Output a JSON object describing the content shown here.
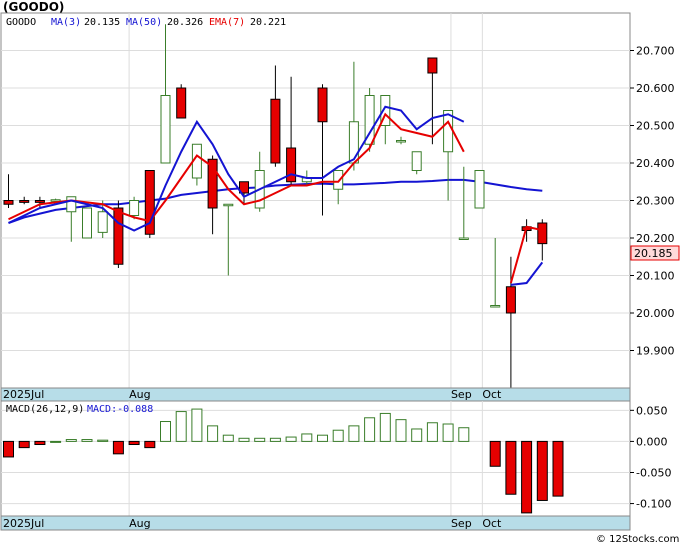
{
  "title": "(GOODO)",
  "legend": {
    "symbol": "GOODO",
    "ma3": "MA(3)",
    "ma3_value": "20.135",
    "ma50": "MA(50)",
    "ma50_value": "20.326",
    "ema7": "EMA(7)",
    "ema7_value": "20.221"
  },
  "macd_legend": {
    "label": "MACD(26,12,9)",
    "value_label": "MACD:-0.088"
  },
  "last_price_tag": "20.185",
  "watermark": "© 12Stocks.com",
  "chart_data": [
    {
      "type": "candlestick",
      "title": "(GOODO)",
      "ylim": [
        19.8,
        20.8
      ],
      "yticks": [
        "19.900",
        "20.000",
        "20.100",
        "20.200",
        "20.300",
        "20.400",
        "20.500",
        "20.600",
        "20.700"
      ],
      "xticks": [
        "2025Jul",
        "Aug",
        "Sep",
        "Oct"
      ],
      "grid": true,
      "colors": {
        "up": "#3a7d2a",
        "down": "#e60000",
        "ma3": "#1414d2",
        "ema7": "#e60000",
        "ma50": "#1414d2"
      },
      "candles": [
        {
          "o": 20.3,
          "h": 20.37,
          "l": 20.28,
          "c": 20.29
        },
        {
          "o": 20.3,
          "h": 20.31,
          "l": 20.29,
          "c": 20.295
        },
        {
          "o": 20.3,
          "h": 20.31,
          "l": 20.28,
          "c": 20.295
        },
        {
          "o": 20.3,
          "h": 20.305,
          "l": 20.295,
          "c": 20.302
        },
        {
          "o": 20.27,
          "h": 20.31,
          "l": 20.19,
          "c": 20.31
        },
        {
          "o": 20.2,
          "h": 20.28,
          "l": 20.2,
          "c": 20.28
        },
        {
          "o": 20.215,
          "h": 20.3,
          "l": 20.2,
          "c": 20.27
        },
        {
          "o": 20.28,
          "h": 20.3,
          "l": 20.12,
          "c": 20.13
        },
        {
          "o": 20.26,
          "h": 20.31,
          "l": 20.25,
          "c": 20.3
        },
        {
          "o": 20.38,
          "h": 20.38,
          "l": 20.2,
          "c": 20.21
        },
        {
          "o": 20.4,
          "h": 20.77,
          "l": 20.42,
          "c": 20.58
        },
        {
          "o": 20.6,
          "h": 20.61,
          "l": 20.52,
          "c": 20.52
        },
        {
          "o": 20.36,
          "h": 20.45,
          "l": 20.34,
          "c": 20.45
        },
        {
          "o": 20.41,
          "h": 20.42,
          "l": 20.21,
          "c": 20.28
        },
        {
          "o": 20.29,
          "h": 20.29,
          "l": 20.1,
          "c": 20.29
        },
        {
          "o": 20.35,
          "h": 20.35,
          "l": 20.29,
          "c": 20.32
        },
        {
          "o": 20.28,
          "h": 20.43,
          "l": 20.27,
          "c": 20.38
        },
        {
          "o": 20.57,
          "h": 20.66,
          "l": 20.39,
          "c": 20.4
        },
        {
          "o": 20.44,
          "h": 20.63,
          "l": 20.34,
          "c": 20.35
        },
        {
          "o": 20.35,
          "h": 20.38,
          "l": 20.34,
          "c": 20.36
        },
        {
          "o": 20.6,
          "h": 20.61,
          "l": 20.26,
          "c": 20.51
        },
        {
          "o": 20.33,
          "h": 20.38,
          "l": 20.29,
          "c": 20.38
        },
        {
          "o": 20.4,
          "h": 20.67,
          "l": 20.38,
          "c": 20.51
        },
        {
          "o": 20.45,
          "h": 20.6,
          "l": 20.43,
          "c": 20.58
        },
        {
          "o": 20.5,
          "h": 20.58,
          "l": 20.45,
          "c": 20.58
        },
        {
          "o": 20.46,
          "h": 20.47,
          "l": 20.45,
          "c": 20.46
        },
        {
          "o": 20.38,
          "h": 20.43,
          "l": 20.37,
          "c": 20.43
        },
        {
          "o": 20.68,
          "h": 20.68,
          "l": 20.45,
          "c": 20.64
        },
        {
          "o": 20.43,
          "h": 20.54,
          "l": 20.3,
          "c": 20.54
        },
        {
          "o": 20.2,
          "h": 20.39,
          "l": 20.2,
          "c": 20.2
        },
        {
          "o": 20.28,
          "h": 20.38,
          "l": 20.28,
          "c": 20.38
        },
        {
          "o": 20.02,
          "h": 20.2,
          "l": 20.02,
          "c": 20.02
        },
        {
          "o": 20.07,
          "h": 20.15,
          "l": 19.8,
          "c": 20.0
        },
        {
          "o": 20.23,
          "h": 20.25,
          "l": 20.19,
          "c": 20.22
        },
        {
          "o": 20.24,
          "h": 20.25,
          "l": 20.14,
          "c": 20.185
        }
      ],
      "series": [
        {
          "name": "MA(3)",
          "values": [
            20.24,
            20.26,
            20.28,
            20.29,
            20.3,
            20.29,
            20.28,
            20.24,
            20.22,
            20.24,
            20.34,
            20.43,
            20.51,
            20.45,
            20.37,
            20.31,
            20.33,
            20.35,
            20.37,
            20.36,
            20.36,
            20.39,
            20.41,
            20.48,
            20.55,
            20.54,
            20.49,
            20.52,
            20.53,
            20.51,
            null,
            null,
            20.075,
            20.08,
            20.135
          ]
        },
        {
          "name": "EMA(7)",
          "values": [
            20.25,
            20.27,
            20.29,
            20.295,
            20.3,
            20.295,
            20.29,
            20.27,
            20.255,
            20.245,
            20.3,
            20.36,
            20.42,
            20.39,
            20.33,
            20.29,
            20.3,
            20.32,
            20.34,
            20.34,
            20.35,
            20.35,
            20.4,
            20.44,
            20.53,
            20.49,
            20.48,
            20.47,
            20.51,
            20.43,
            null,
            null,
            20.08,
            20.23,
            20.221
          ]
        },
        {
          "name": "MA(50)",
          "values": [
            20.24,
            20.255,
            20.265,
            20.275,
            20.28,
            20.285,
            20.29,
            20.29,
            20.295,
            20.3,
            20.305,
            20.315,
            20.32,
            20.325,
            20.33,
            20.333,
            20.335,
            20.34,
            20.342,
            20.344,
            20.345,
            20.343,
            20.343,
            20.345,
            20.347,
            20.35,
            20.35,
            20.352,
            20.355,
            20.355,
            20.35,
            20.343,
            20.336,
            20.33,
            20.326
          ]
        }
      ]
    },
    {
      "type": "bar",
      "title": "MACD(26,12,9)",
      "ylim": [
        -0.12,
        0.065
      ],
      "yticks": [
        "0.050",
        "0.000",
        "-0.050",
        "-0.100"
      ],
      "xticks": [
        "2025Jul",
        "Aug",
        "Sep",
        "Oct"
      ],
      "grid": true,
      "values": [
        -0.025,
        -0.01,
        -0.005,
        0.0,
        0.003,
        0.003,
        0.002,
        -0.02,
        -0.005,
        -0.01,
        0.032,
        0.048,
        0.052,
        0.025,
        0.01,
        0.005,
        0.005,
        0.005,
        0.007,
        0.012,
        0.01,
        0.018,
        0.025,
        0.038,
        0.045,
        0.035,
        0.02,
        0.03,
        0.028,
        0.022,
        null,
        -0.04,
        -0.085,
        -0.115,
        -0.095,
        -0.088
      ]
    }
  ]
}
